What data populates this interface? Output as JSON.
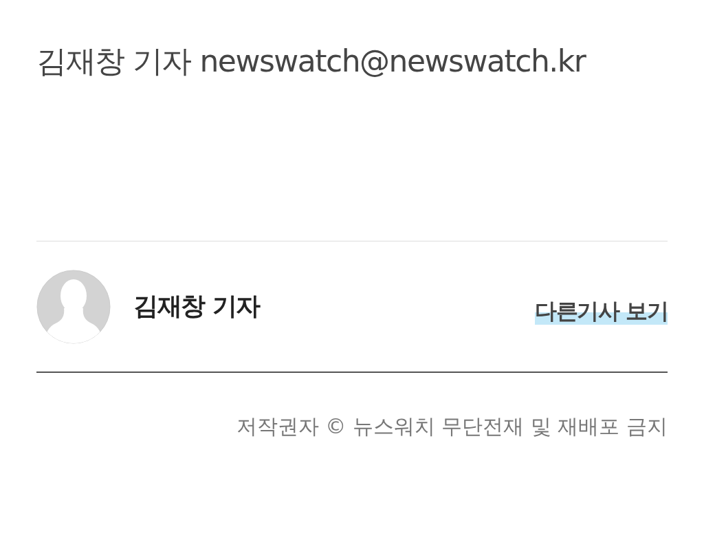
{
  "byline": {
    "text": "김재창 기자 newswatch@newswatch.kr"
  },
  "author_box": {
    "name": "김재창 기자",
    "link": "다른기사 보기"
  },
  "copyright": {
    "text": "저작권자 © 뉴스워치 무단전재 및 재배포 금지"
  }
}
